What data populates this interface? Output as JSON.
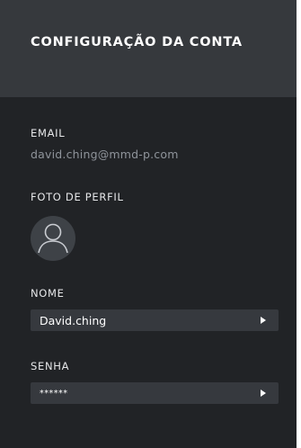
{
  "header": {
    "title": "CONFIGURAÇÃO DA CONTA"
  },
  "email": {
    "label": "EMAIL",
    "value": "david.ching@mmd-p.com"
  },
  "profile_photo": {
    "label": "FOTO DE PERFIL",
    "icon": "user-icon"
  },
  "name": {
    "label": "NOME",
    "value": "David.ching",
    "icon": "triangle-right-icon"
  },
  "password": {
    "label": "SENHA",
    "value": "******",
    "icon": "triangle-right-icon"
  },
  "colors": {
    "panel_background": "#212326",
    "header_background": "#36393d",
    "field_background": "#36393e",
    "muted_text": "#8f949b"
  }
}
